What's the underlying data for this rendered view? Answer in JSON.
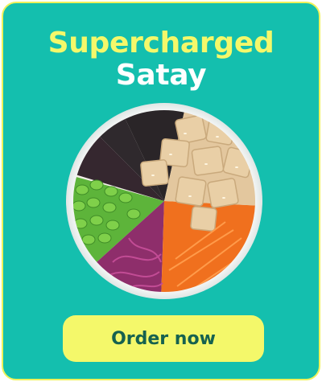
{
  "promo": {
    "title_line1": "Supercharged",
    "title_line2": "Satay",
    "cta_label": "Order now",
    "image": "poke-bowl-with-tofu-edamame-cabbage-carrot-black-rice"
  },
  "colors": {
    "background": "#14bfae",
    "accent": "#f4f86a",
    "button_text": "#16624f",
    "border": "#eef25a"
  }
}
